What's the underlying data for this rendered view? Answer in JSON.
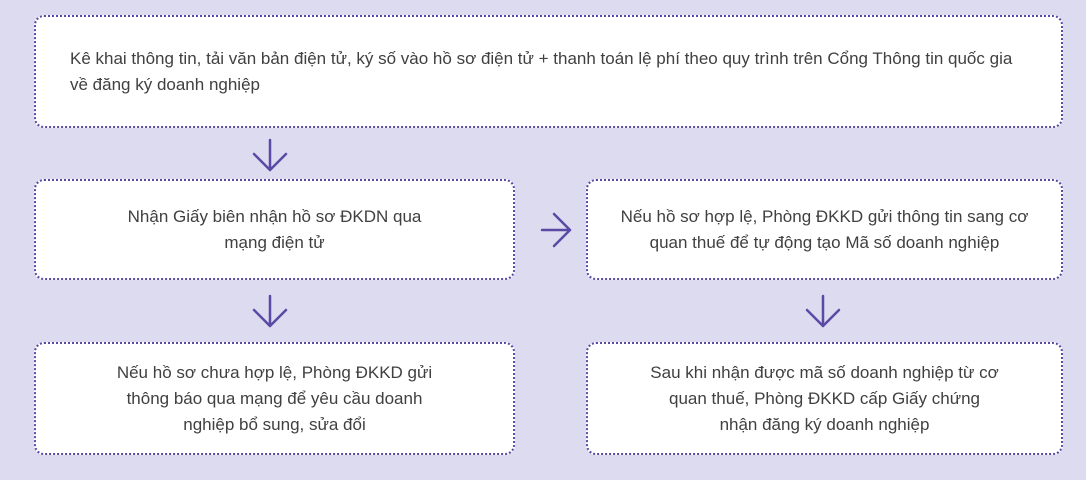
{
  "steps": {
    "step1": "Kê khai thông tin, tải văn bản điện tử, ký số vào hồ sơ điện tử + thanh toán lệ phí theo quy trình trên Cổng Thông tin quốc gia về đăng ký doanh nghiệp",
    "step2": "Nhận Giấy biên nhận hồ sơ ĐKDN qua mạng điện tử",
    "step3": "Nếu hồ sơ hợp lệ, Phòng ĐKKD gửi thông tin sang cơ quan thuế để tự động tạo Mã số doanh nghiệp",
    "step4": "Nếu hồ sơ chưa hợp lệ, Phòng ĐKKD gửi thông báo qua mạng để yêu cầu doanh nghiệp bổ sung, sửa đổi",
    "step5": "Sau khi nhận được mã số doanh nghiệp từ cơ quan thuế, Phòng ĐKKD cấp Giấy chứng nhận đăng ký doanh nghiệp"
  },
  "colors": {
    "background": "#dddbef",
    "accent": "#5a4aa5",
    "box": "#ffffff",
    "text": "#404040"
  },
  "icons": {
    "down": "arrow-down-icon",
    "right": "arrow-right-icon"
  }
}
